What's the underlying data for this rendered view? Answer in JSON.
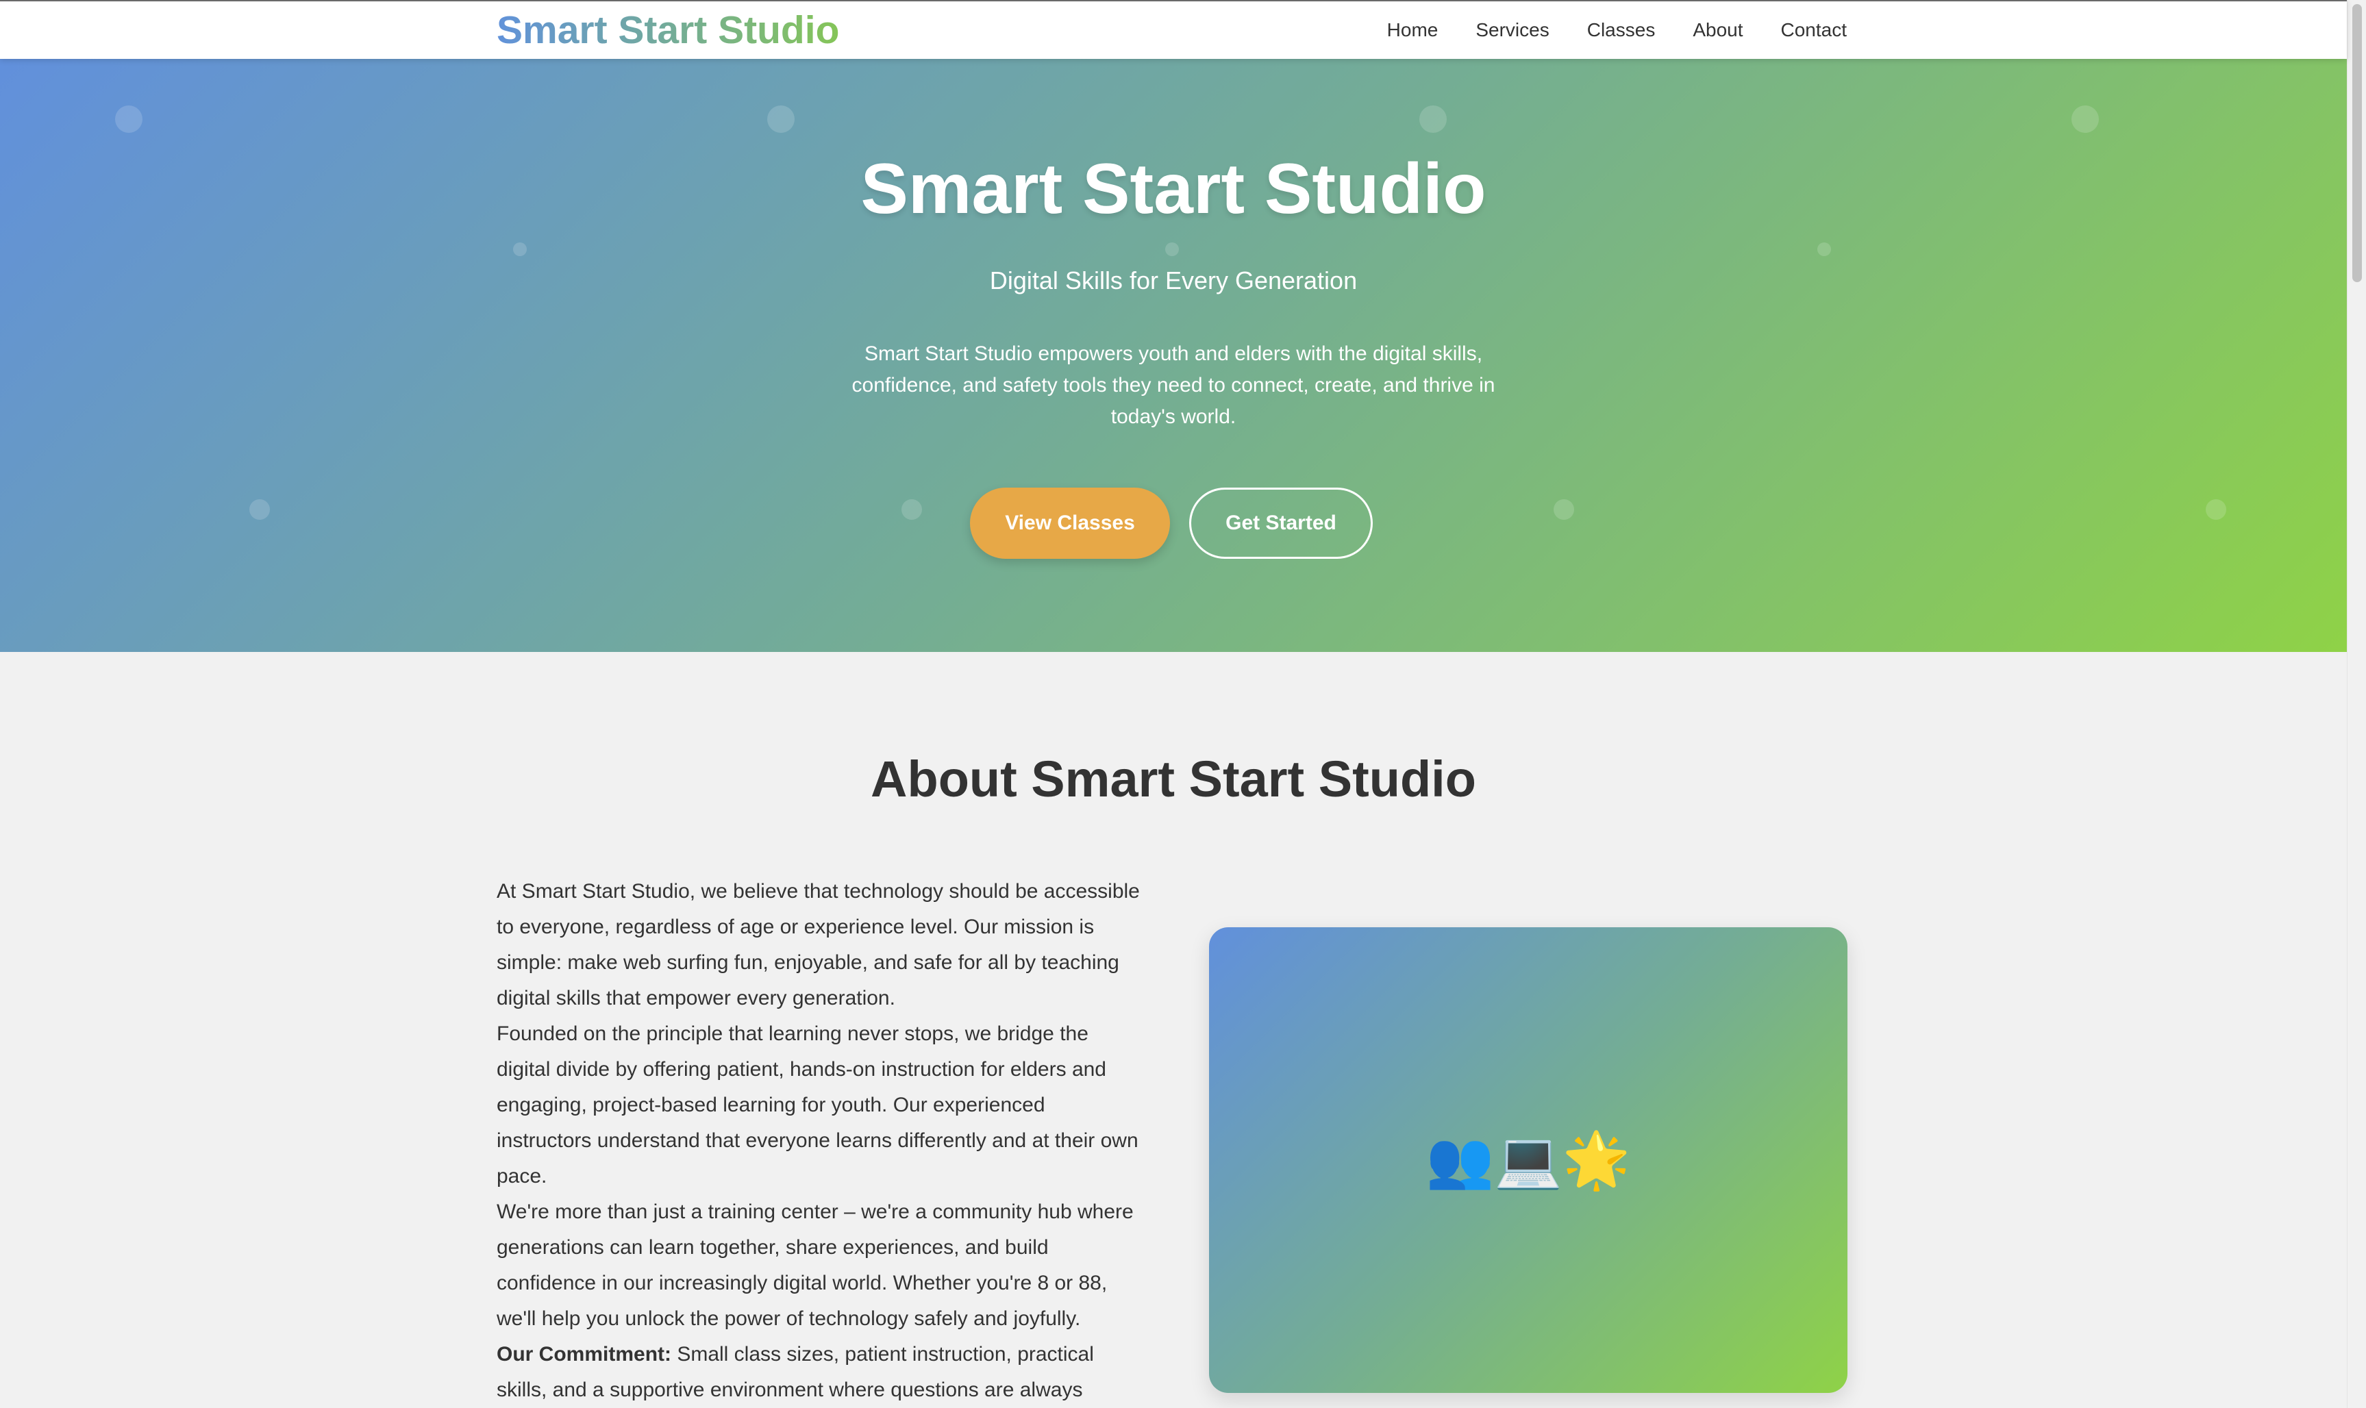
{
  "header": {
    "logo": "Smart Start Studio",
    "nav": [
      {
        "label": "Home"
      },
      {
        "label": "Services"
      },
      {
        "label": "Classes"
      },
      {
        "label": "About"
      },
      {
        "label": "Contact"
      }
    ]
  },
  "hero": {
    "title": "Smart Start Studio",
    "subtitle": "Digital Skills for Every Generation",
    "description": "Smart Start Studio empowers youth and elders with the digital skills, confidence, and safety tools they need to connect, create, and thrive in today's world.",
    "primary_button": "View Classes",
    "secondary_button": "Get Started"
  },
  "about": {
    "title": "About Smart Start Studio",
    "paragraphs": [
      "At Smart Start Studio, we believe that technology should be accessible to everyone, regardless of age or experience level. Our mission is simple: make web surfing fun, enjoyable, and safe for all by teaching digital skills that empower every generation.",
      "Founded on the principle that learning never stops, we bridge the digital divide by offering patient, hands-on instruction for elders and engaging, project-based learning for youth. Our experienced instructors understand that everyone learns differently and at their own pace.",
      "We're more than just a training center – we're a community hub where generations can learn together, share experiences, and build confidence in our increasingly digital world. Whether you're 8 or 88, we'll help you unlock the power of technology safely and joyfully."
    ],
    "commitment_label": "Our Commitment:",
    "commitment_text": " Small class sizes, patient instruction, practical skills, and a supportive environment where questions are always",
    "image_emoji": "👥💻🌟"
  },
  "colors": {
    "gradient_start": "#6190dc",
    "gradient_end": "#8fd247",
    "accent_button": "#e7a847",
    "text_dark": "#333333"
  }
}
